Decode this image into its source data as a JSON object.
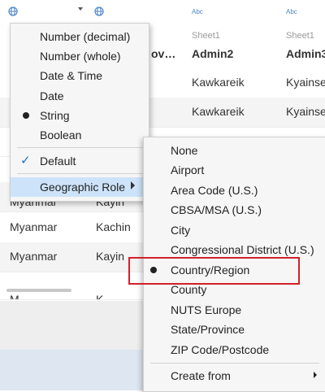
{
  "colors": {
    "accent": "#4a86c5",
    "highlight": "#cde3fa",
    "annotation": "#d2202b"
  },
  "headers": [
    {
      "type": "",
      "source": "",
      "name": ""
    },
    {
      "type": "",
      "source": "",
      "name": "ov…"
    },
    {
      "type": "Abc",
      "source": "Sheet1",
      "name": "Admin2"
    },
    {
      "type": "Abc",
      "source": "Sheet1",
      "name": "Admin3"
    }
  ],
  "rows": [
    {
      "c3": "Kawkareik",
      "c4": "Kyainse"
    },
    {
      "c3": "Kawkareik",
      "c4": "Kyainse"
    },
    {
      "c3": "",
      "c4": ""
    },
    {
      "c1": "Myanmar",
      "c2": "Kayin",
      "c3": "",
      "c4": ""
    },
    {
      "c1": "Myanmar",
      "c2": "Kachin",
      "c3": "",
      "c4": ""
    },
    {
      "c1": "Myanmar",
      "c2": "Kayin",
      "c3": "",
      "c4": ""
    },
    {
      "c1": "M",
      "c2": "K",
      "c3": "",
      "c4": ""
    }
  ],
  "type_menu": {
    "items": [
      {
        "label": "Number (decimal)"
      },
      {
        "label": "Number (whole)"
      },
      {
        "label": "Date & Time"
      },
      {
        "label": "Date"
      },
      {
        "label": "String",
        "selected": true
      },
      {
        "label": "Boolean"
      }
    ],
    "default_label": "Default",
    "geo_role_label": "Geographic Role"
  },
  "geo_menu": {
    "items": [
      {
        "label": "None"
      },
      {
        "label": "Airport"
      },
      {
        "label": "Area Code (U.S.)"
      },
      {
        "label": "CBSA/MSA (U.S.)"
      },
      {
        "label": "City"
      },
      {
        "label": "Congressional District (U.S.)"
      },
      {
        "label": "Country/Region",
        "selected": true
      },
      {
        "label": "County"
      },
      {
        "label": "NUTS Europe"
      },
      {
        "label": "State/Province"
      },
      {
        "label": "ZIP Code/Postcode"
      }
    ],
    "create_from_label": "Create from"
  }
}
